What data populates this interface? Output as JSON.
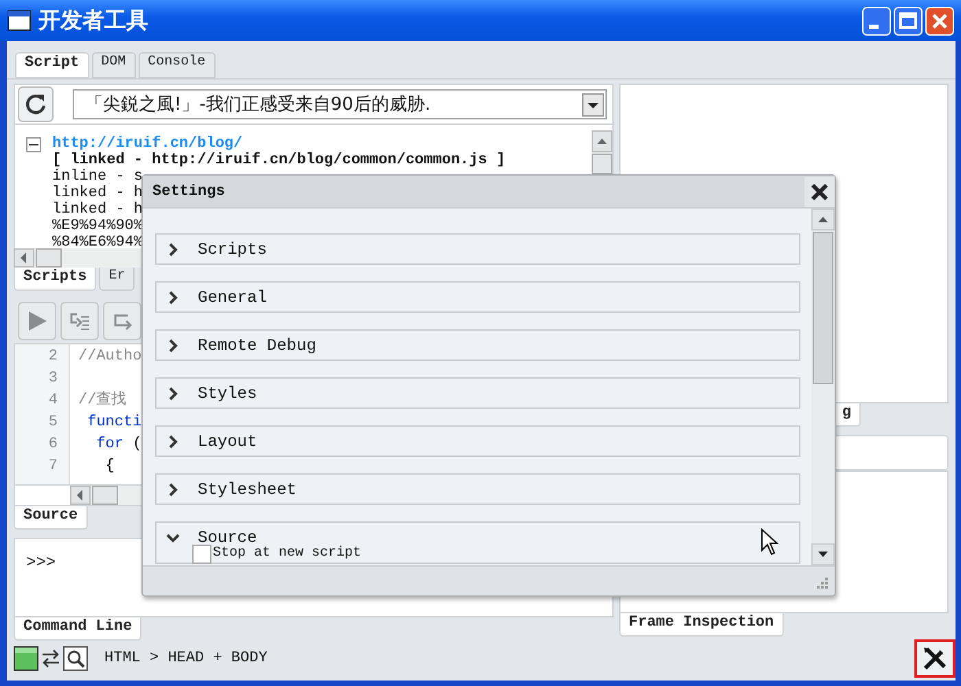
{
  "window": {
    "title": "开发者工具"
  },
  "tabs": [
    {
      "label": "Script",
      "selected": true
    },
    {
      "label": "DOM",
      "selected": false
    },
    {
      "label": "Console",
      "selected": false
    }
  ],
  "script_selector": {
    "value": "「尖鋭之風!」-我们正感受来自90后的威胁."
  },
  "script_list": [
    {
      "text": "http://iruif.cn/blog/",
      "expanded": true,
      "children": [
        {
          "text": "[ linked - http://iruif.cn/blog/common/common.js ]",
          "kind": "current"
        },
        {
          "text": "inline - s",
          "kind": "plain"
        },
        {
          "text": "linked - h",
          "kind": "plain"
        },
        {
          "text": "linked - h",
          "kind": "plain"
        },
        {
          "text": "%E9%94%90%",
          "kind": "plain"
        },
        {
          "text": "%84%E6%94%",
          "kind": "plain"
        }
      ]
    }
  ],
  "script_tabs": [
    {
      "label": "Scripts",
      "selected": true
    },
    {
      "label": "Er",
      "selected": false
    }
  ],
  "source": {
    "lines": [
      {
        "number": "2",
        "tokens": [
          {
            "text": "//Autho",
            "kind": "comment"
          }
        ]
      },
      {
        "number": "3"
      },
      {
        "number": "4",
        "tokens": [
          {
            "text": "//查找",
            "kind": "comment"
          }
        ]
      },
      {
        "number": "5",
        "tokens": [
          {
            "text": " functi",
            "kind": "keyword"
          }
        ]
      },
      {
        "number": "6",
        "tokens": [
          {
            "text": "  for",
            "kind": "keyword"
          },
          {
            "text": " (",
            "kind": "plain"
          }
        ]
      },
      {
        "number": "7",
        "tokens": [
          {
            "text": "   {",
            "kind": "plain"
          }
        ]
      }
    ]
  },
  "source_tabs": [
    {
      "label": "Source",
      "selected": true
    }
  ],
  "command_line": {
    "prompt": ">>>"
  },
  "command_tabs": [
    {
      "label": "Command Line",
      "selected": true
    }
  ],
  "right_tabs": [
    {
      "label": "g",
      "selected": true
    }
  ],
  "frame_tabs": [
    {
      "label": "Frame Inspection",
      "selected": true
    }
  ],
  "status_bar": {
    "breadcrumb": "HTML > HEAD + BODY"
  },
  "settings": {
    "title": "Settings",
    "sections": [
      {
        "label": "Scripts",
        "expanded": false
      },
      {
        "label": "General",
        "expanded": false
      },
      {
        "label": "Remote Debug",
        "expanded": false
      },
      {
        "label": "Styles",
        "expanded": false
      },
      {
        "label": "Layout",
        "expanded": false
      },
      {
        "label": "Stylesheet",
        "expanded": false
      },
      {
        "label": "Source",
        "expanded": true,
        "options": [
          {
            "label": "Stop at new script",
            "checked": false
          }
        ]
      }
    ]
  }
}
